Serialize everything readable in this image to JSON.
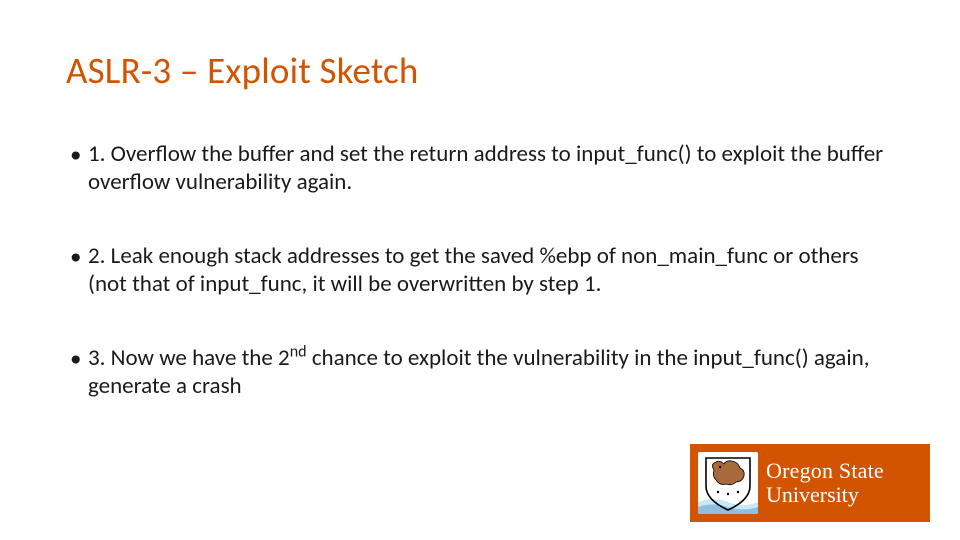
{
  "title": "ASLR-3 – Exploit Sketch",
  "bullets": [
    "1. Overflow the buffer and set the return address to input_func() to exploit the buffer overflow vulnerability again.",
    "2. Leak enough stack addresses to get the saved %ebp of non_main_func or others (not that of input_func, it will be overwritten by step 1.",
    "3. Now we have the 2<sup>nd</sup> chance to exploit the vulnerability in the input_func() again, generate a crash"
  ],
  "logo": {
    "line1": "Oregon State",
    "line2": "University",
    "accent": "#d35400"
  }
}
